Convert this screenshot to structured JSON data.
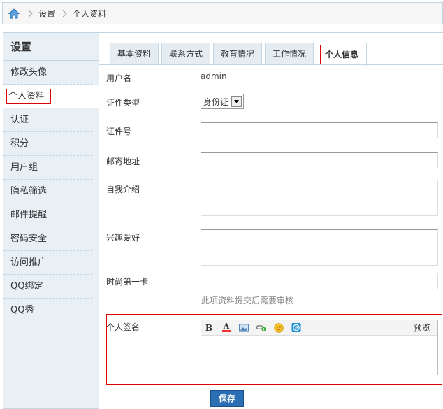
{
  "breadcrumb": {
    "items": [
      "设置",
      "个人资料"
    ]
  },
  "sidebar": {
    "title": "设置",
    "items": [
      {
        "label": "修改头像"
      },
      {
        "label": "个人资料"
      },
      {
        "label": "认证"
      },
      {
        "label": "积分"
      },
      {
        "label": "用户组"
      },
      {
        "label": "隐私筛选"
      },
      {
        "label": "邮件提醒"
      },
      {
        "label": "密码安全"
      },
      {
        "label": "访问推广"
      },
      {
        "label": "QQ绑定"
      },
      {
        "label": "QQ秀"
      }
    ],
    "active_index": 1
  },
  "tabs": [
    {
      "label": "基本资料"
    },
    {
      "label": "联系方式"
    },
    {
      "label": "教育情况"
    },
    {
      "label": "工作情况"
    },
    {
      "label": "个人信息"
    }
  ],
  "form": {
    "username_label": "用户名",
    "username_value": "admin",
    "idtype_label": "证件类型",
    "idtype_value": "身份证",
    "idnum_label": "证件号",
    "address_label": "邮寄地址",
    "bio_label": "自我介绍",
    "interest_label": "兴趣爱好",
    "fashion_label": "时尚第一卡",
    "review_hint": "此项资料提交后需要审核",
    "signature_label": "个人签名",
    "editor_preview": "预览",
    "save_label": "保存"
  },
  "colors": {
    "accent": "#2a6fb3",
    "border": "#c2d5e3",
    "highlight": "#dd0000"
  }
}
